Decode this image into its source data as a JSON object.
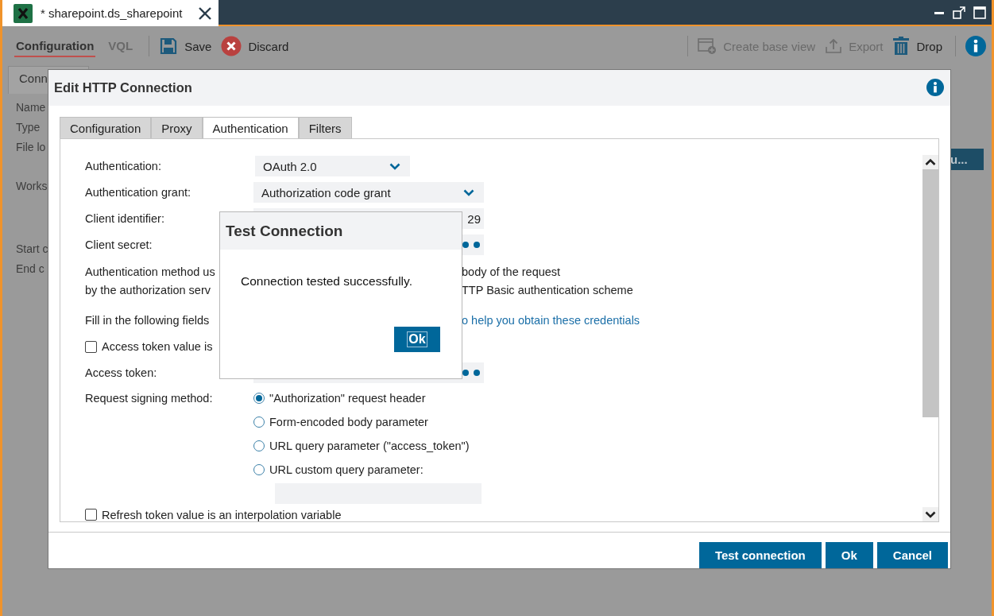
{
  "window": {
    "tab_title": "* sharepoint.ds_sharepoint"
  },
  "toolbar": {
    "view_tabs": [
      {
        "label": "Configuration",
        "selected": true
      },
      {
        "label": "VQL",
        "selected": false
      }
    ],
    "left_actions": [
      {
        "kind": "save",
        "label": "Save",
        "disabled": false
      },
      {
        "kind": "discard",
        "label": "Discard",
        "disabled": false
      }
    ],
    "right_actions": [
      {
        "kind": "create",
        "label": "Create base view",
        "disabled": true
      },
      {
        "kind": "export",
        "label": "Export",
        "disabled": true
      },
      {
        "kind": "drop",
        "label": "Drop",
        "disabled": false
      }
    ]
  },
  "background": {
    "tab": "Conn",
    "labels": [
      "Name",
      "Type",
      "File lo",
      "Works",
      "Start c",
      "End c"
    ],
    "button": "u..."
  },
  "dialog": {
    "title": "Edit HTTP Connection",
    "tabs": [
      {
        "label": "Configuration",
        "selected": false
      },
      {
        "label": "Proxy",
        "selected": false
      },
      {
        "label": "Authentication",
        "selected": true
      },
      {
        "label": "Filters",
        "selected": false
      }
    ],
    "form": [
      {
        "kind": "select",
        "label": "Authentication:",
        "value": "OAuth 2.0"
      },
      {
        "kind": "select",
        "label": "Authentication grant:",
        "value": "Authorization code grant"
      },
      {
        "kind": "field",
        "label": "Client identifier:",
        "value": "29"
      },
      {
        "kind": "masked",
        "label": "Client secret:"
      },
      {
        "kind": "note",
        "lines": [
          {
            "left": "Authentication method us",
            "right": "body of the request",
            "link": false
          },
          {
            "left": "by the authorization serv",
            "right": "TTP Basic authentication scheme",
            "link": false
          }
        ]
      },
      {
        "kind": "note",
        "lines": [
          {
            "left": "Fill in the following fields",
            "right": "o help you obtain these credentials",
            "link": true
          }
        ]
      },
      {
        "kind": "checkbox",
        "label": "Access token value is",
        "checked": false
      },
      {
        "kind": "masked",
        "label": "Access token:"
      },
      {
        "kind": "radios",
        "label": "Request signing method:",
        "options": [
          {
            "label": "\"Authorization\" request header",
            "selected": true
          },
          {
            "label": "Form-encoded body parameter",
            "selected": false
          },
          {
            "label": "URL query parameter (\"access_token\")",
            "selected": false
          },
          {
            "label": "URL custom query parameter:",
            "selected": false
          }
        ]
      },
      {
        "kind": "checkbox",
        "label": "Refresh token value is an interpolation variable",
        "checked": false
      }
    ],
    "buttons": [
      "Test connection",
      "Ok",
      "Cancel"
    ]
  },
  "popup": {
    "title": "Test Connection",
    "message": "Connection tested successfully.",
    "button": "Ok"
  }
}
